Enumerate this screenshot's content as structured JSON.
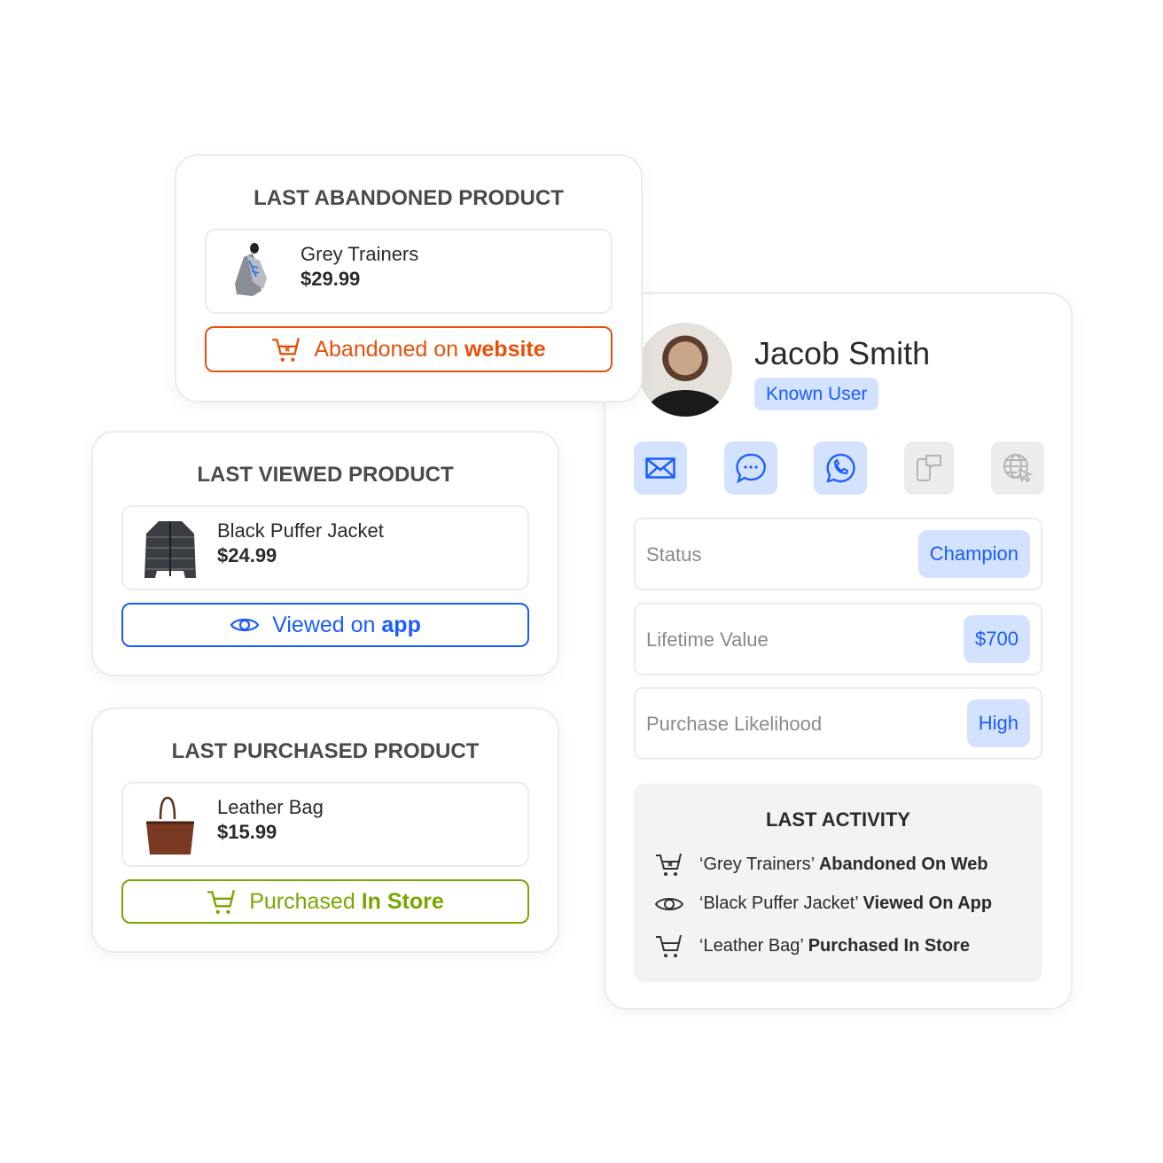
{
  "colors": {
    "orange": "#e8500a",
    "blue": "#1a5cff",
    "green": "#78a700",
    "chip": "#d3e2ff"
  },
  "abandoned": {
    "title": "LAST ABANDONED PRODUCT",
    "name": "Grey Trainers",
    "price": "$29.99",
    "action_prefix": "Abandoned on ",
    "action_bold": "website",
    "icon": "cart-x-icon"
  },
  "viewed": {
    "title": "LAST VIEWED PRODUCT",
    "name": "Black Puffer Jacket",
    "price": "$24.99",
    "action_prefix": "Viewed on ",
    "action_bold": "app",
    "icon": "eye-icon"
  },
  "purchased": {
    "title": "LAST PURCHASED PRODUCT",
    "name": "Leather Bag",
    "price": "$15.99",
    "action_prefix": "Purchased ",
    "action_bold": "In Store",
    "icon": "cart-icon"
  },
  "profile": {
    "name": "Jacob Smith",
    "badge": "Known User",
    "channels": [
      {
        "icon": "email-icon",
        "active": true
      },
      {
        "icon": "chat-icon",
        "active": true
      },
      {
        "icon": "whatsapp-icon",
        "active": true
      },
      {
        "icon": "sms-icon",
        "active": false
      },
      {
        "icon": "web-icon",
        "active": false
      }
    ],
    "rows": [
      {
        "label": "Status",
        "value": "Champion"
      },
      {
        "label": "Lifetime Value",
        "value": "$700"
      },
      {
        "label": "Purchase Likelihood",
        "value": "High"
      }
    ],
    "activity": {
      "title": "LAST ACTIVITY",
      "items": [
        {
          "icon": "cart-x-icon",
          "text": "‘Grey Trainers’ ",
          "bold": "Abandoned On Web"
        },
        {
          "icon": "eye-icon",
          "text": "‘Black Puffer Jacket’ ",
          "bold": "Viewed On App"
        },
        {
          "icon": "cart-icon",
          "text": "‘Leather Bag’ ",
          "bold": "Purchased In Store"
        }
      ]
    }
  }
}
